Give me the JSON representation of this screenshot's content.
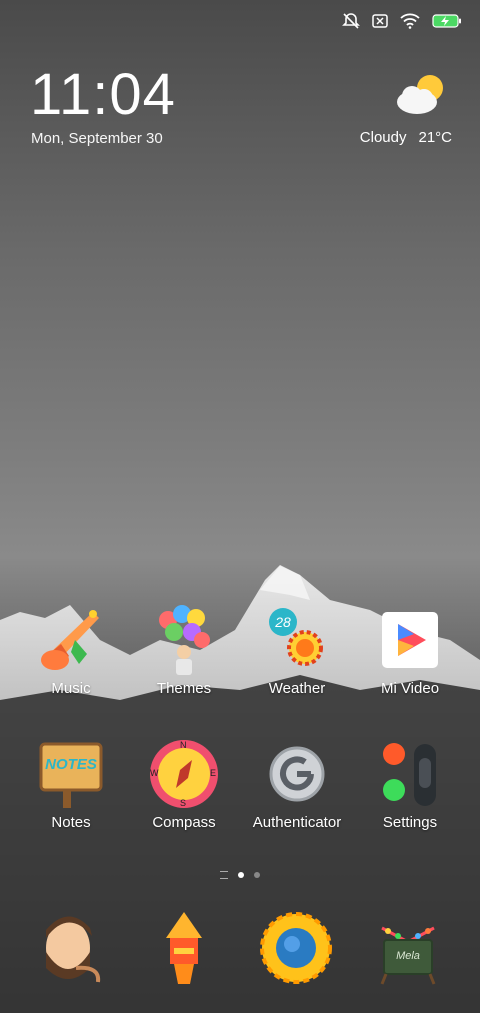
{
  "status_bar": {
    "icons": [
      "notifications-off-icon",
      "no-sim-icon",
      "wifi-icon",
      "battery-charging-icon"
    ]
  },
  "lockscreen_clock": {
    "time": "11:04",
    "date": "Mon, September 30"
  },
  "weather": {
    "condition": "Cloudy",
    "temperature": "21°C",
    "icon": "partly-cloudy-icon"
  },
  "apps_row1": [
    {
      "label": "Music",
      "icon": "trumpet-icon"
    },
    {
      "label": "Themes",
      "icon": "balloons-icon"
    },
    {
      "label": "Weather",
      "icon": "sun-badge-icon",
      "badge": "28"
    },
    {
      "label": "Mi Video",
      "icon": "play-icon"
    }
  ],
  "apps_row2": [
    {
      "label": "Notes",
      "icon": "notes-sign-icon",
      "sign_text": "NOTES"
    },
    {
      "label": "Compass",
      "icon": "compass-icon",
      "directions": [
        "N",
        "E",
        "S",
        "W"
      ]
    },
    {
      "label": "Authenticator",
      "icon": "authenticator-icon"
    },
    {
      "label": "Settings",
      "icon": "toggle-switch-icon"
    }
  ],
  "dock": [
    {
      "icon": "bearded-man-icon"
    },
    {
      "icon": "lantern-icon"
    },
    {
      "icon": "sunflower-icon"
    },
    {
      "icon": "mela-board-icon",
      "text": "Mela"
    }
  ],
  "page_indicator": {
    "pages": 2,
    "active": 1
  },
  "colors": {
    "battery": "#4cd964",
    "compass_ring": "#f04f6e",
    "badge": "#2bb6c9"
  }
}
